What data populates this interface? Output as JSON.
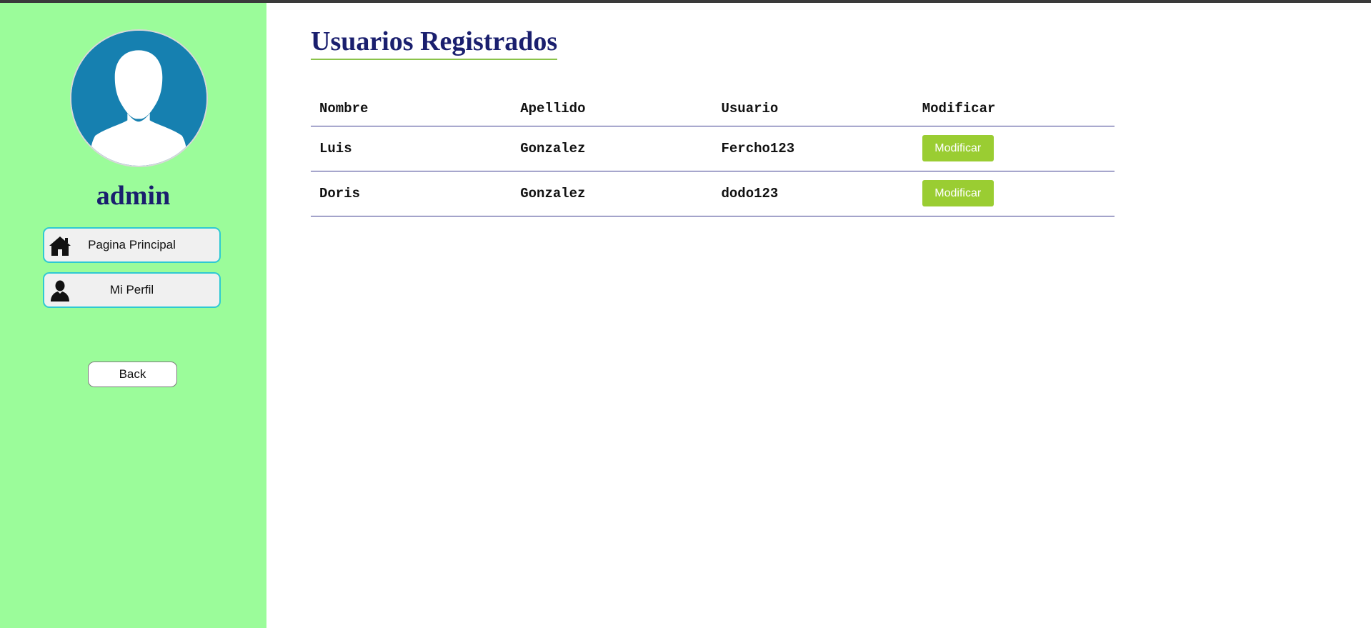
{
  "sidebar": {
    "username": "admin",
    "avatar_icon": "user-silhouette-icon",
    "nav": [
      {
        "label": "Pagina Principal",
        "icon": "home-icon"
      },
      {
        "label": "Mi Perfil",
        "icon": "user-icon"
      }
    ],
    "back_label": "Back"
  },
  "main": {
    "title": "Usuarios Registrados",
    "table": {
      "headers": [
        "Nombre",
        "Apellido",
        "Usuario",
        "Modificar"
      ],
      "rows": [
        {
          "nombre": "Luis",
          "apellido": "Gonzalez",
          "usuario": "Fercho123",
          "action_label": "Modificar"
        },
        {
          "nombre": "Doris",
          "apellido": "Gonzalez",
          "usuario": "dodo123",
          "action_label": "Modificar"
        }
      ]
    }
  },
  "colors": {
    "sidebar_bg": "#9bfc9a",
    "title_color": "#1a1f6e",
    "accent_button": "#9acd32",
    "nav_border": "#2ec9d2",
    "avatar_bg": "#1680b0"
  }
}
